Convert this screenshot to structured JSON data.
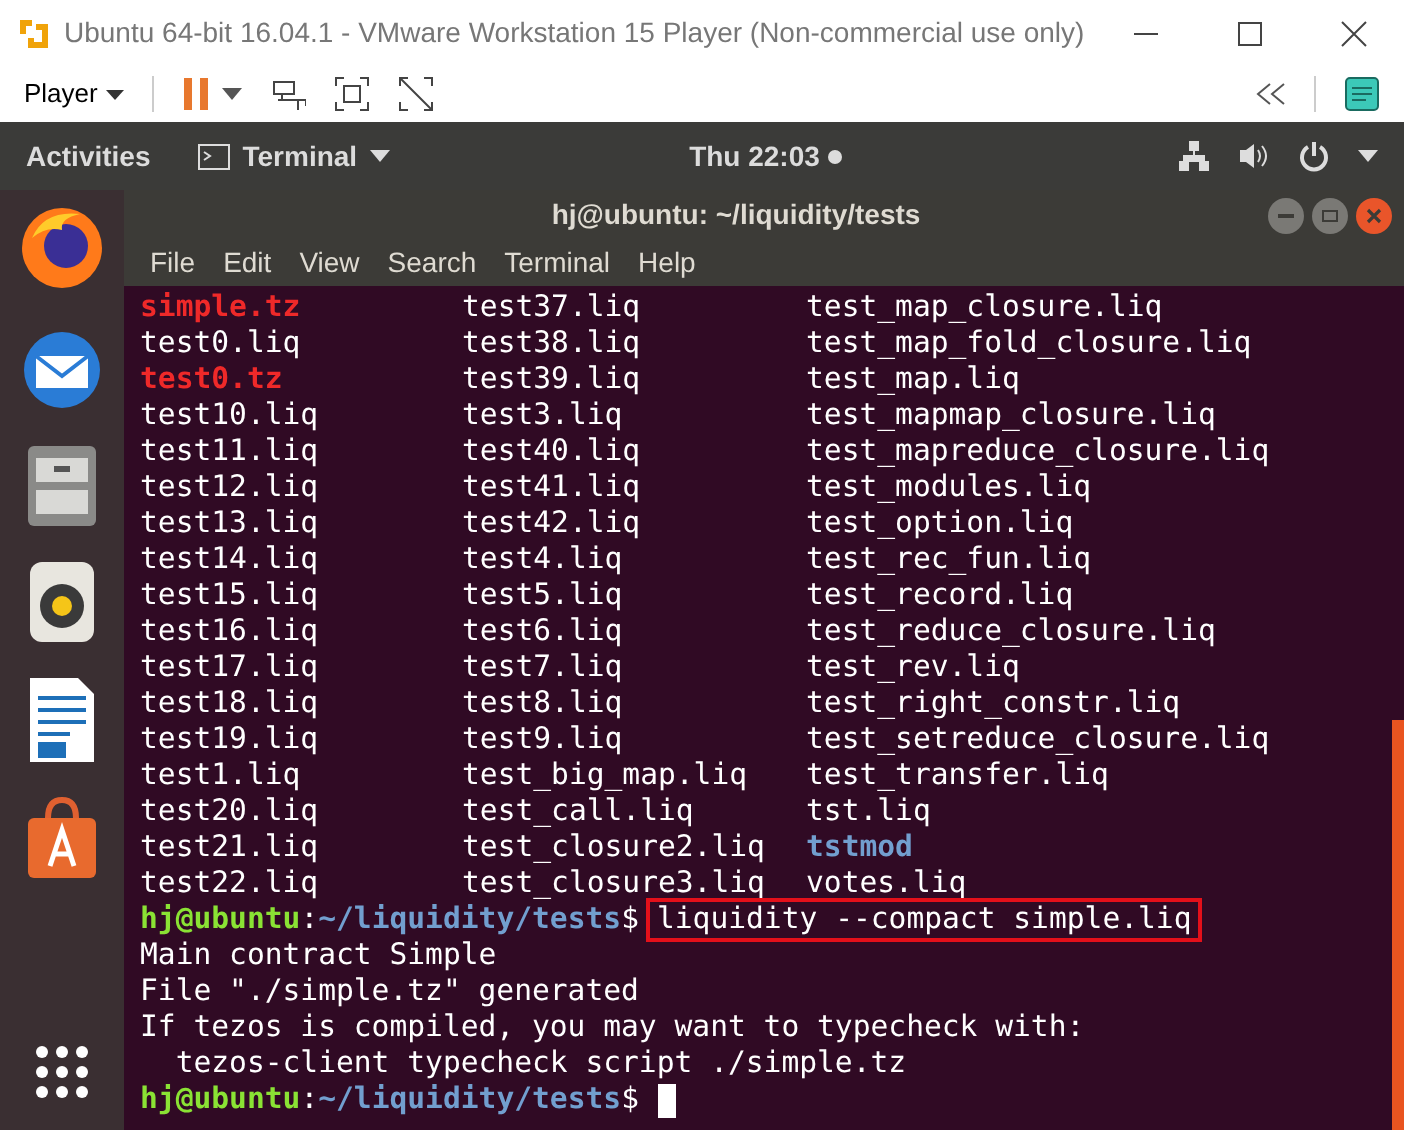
{
  "vm_window": {
    "title": "Ubuntu 64-bit 16.04.1 - VMware Workstation 15 Player (Non-commercial use only)",
    "menu": "Player"
  },
  "top_bar": {
    "activities": "Activities",
    "app_menu": "Terminal",
    "clock": "Thu 22:03"
  },
  "terminal": {
    "title": "hj@ubuntu: ~/liquidity/tests",
    "menu": [
      "File",
      "Edit",
      "View",
      "Search",
      "Terminal",
      "Help"
    ],
    "listing": [
      [
        {
          "text": "simple.tz",
          "kind": "tz"
        },
        {
          "text": "test37.liq",
          "kind": "file"
        },
        {
          "text": "test_map_closure.liq",
          "kind": "file"
        }
      ],
      [
        {
          "text": "test0.liq",
          "kind": "file"
        },
        {
          "text": "test38.liq",
          "kind": "file"
        },
        {
          "text": "test_map_fold_closure.liq",
          "kind": "file"
        }
      ],
      [
        {
          "text": "test0.tz",
          "kind": "tz"
        },
        {
          "text": "test39.liq",
          "kind": "file"
        },
        {
          "text": "test_map.liq",
          "kind": "file"
        }
      ],
      [
        {
          "text": "test10.liq",
          "kind": "file"
        },
        {
          "text": "test3.liq",
          "kind": "file"
        },
        {
          "text": "test_mapmap_closure.liq",
          "kind": "file"
        }
      ],
      [
        {
          "text": "test11.liq",
          "kind": "file"
        },
        {
          "text": "test40.liq",
          "kind": "file"
        },
        {
          "text": "test_mapreduce_closure.liq",
          "kind": "file"
        }
      ],
      [
        {
          "text": "test12.liq",
          "kind": "file"
        },
        {
          "text": "test41.liq",
          "kind": "file"
        },
        {
          "text": "test_modules.liq",
          "kind": "file"
        }
      ],
      [
        {
          "text": "test13.liq",
          "kind": "file"
        },
        {
          "text": "test42.liq",
          "kind": "file"
        },
        {
          "text": "test_option.liq",
          "kind": "file"
        }
      ],
      [
        {
          "text": "test14.liq",
          "kind": "file"
        },
        {
          "text": "test4.liq",
          "kind": "file"
        },
        {
          "text": "test_rec_fun.liq",
          "kind": "file"
        }
      ],
      [
        {
          "text": "test15.liq",
          "kind": "file"
        },
        {
          "text": "test5.liq",
          "kind": "file"
        },
        {
          "text": "test_record.liq",
          "kind": "file"
        }
      ],
      [
        {
          "text": "test16.liq",
          "kind": "file"
        },
        {
          "text": "test6.liq",
          "kind": "file"
        },
        {
          "text": "test_reduce_closure.liq",
          "kind": "file"
        }
      ],
      [
        {
          "text": "test17.liq",
          "kind": "file"
        },
        {
          "text": "test7.liq",
          "kind": "file"
        },
        {
          "text": "test_rev.liq",
          "kind": "file"
        }
      ],
      [
        {
          "text": "test18.liq",
          "kind": "file"
        },
        {
          "text": "test8.liq",
          "kind": "file"
        },
        {
          "text": "test_right_constr.liq",
          "kind": "file"
        }
      ],
      [
        {
          "text": "test19.liq",
          "kind": "file"
        },
        {
          "text": "test9.liq",
          "kind": "file"
        },
        {
          "text": "test_setreduce_closure.liq",
          "kind": "file"
        }
      ],
      [
        {
          "text": "test1.liq",
          "kind": "file"
        },
        {
          "text": "test_big_map.liq",
          "kind": "file"
        },
        {
          "text": "test_transfer.liq",
          "kind": "file"
        }
      ],
      [
        {
          "text": "test20.liq",
          "kind": "file"
        },
        {
          "text": "test_call.liq",
          "kind": "file"
        },
        {
          "text": "tst.liq",
          "kind": "file"
        }
      ],
      [
        {
          "text": "test21.liq",
          "kind": "file"
        },
        {
          "text": "test_closure2.liq",
          "kind": "file"
        },
        {
          "text": "tstmod",
          "kind": "dir"
        }
      ],
      [
        {
          "text": "test22.liq",
          "kind": "file"
        },
        {
          "text": "test_closure3.liq",
          "kind": "file"
        },
        {
          "text": "votes.liq",
          "kind": "file"
        }
      ]
    ],
    "lines": [
      {
        "kind": "prompt",
        "user": "hj@ubuntu",
        "separator": ":",
        "path": "~/liquidity/tests",
        "sign": "$",
        "command": "liquidity --compact simple.liq",
        "highlighted": true,
        "cursor": false
      },
      {
        "kind": "output",
        "text": "Main contract Simple"
      },
      {
        "kind": "output",
        "text": "File \"./simple.tz\" generated"
      },
      {
        "kind": "output",
        "text": "If tezos is compiled, you may want to typecheck with:"
      },
      {
        "kind": "output",
        "text": "  tezos-client typecheck script ./simple.tz"
      },
      {
        "kind": "prompt",
        "user": "hj@ubuntu",
        "separator": ":",
        "path": "~/liquidity/tests",
        "sign": "$",
        "cursor": true
      }
    ]
  }
}
